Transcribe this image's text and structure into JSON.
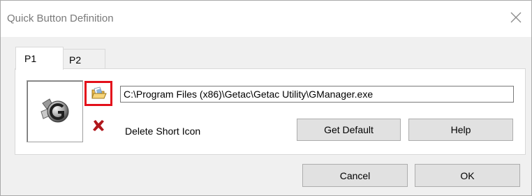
{
  "window": {
    "title": "Quick Button Definition"
  },
  "tabs": [
    {
      "label": "P1",
      "selected": true
    },
    {
      "label": "P2",
      "selected": false
    }
  ],
  "icon_preview": {
    "icon": "getac-gear-icon"
  },
  "browse": {
    "icon": "folder-open-icon"
  },
  "path_field": {
    "value": "C:\\Program Files (x86)\\Getac\\Getac Utility\\GManager.exe"
  },
  "delete": {
    "icon": "red-x-icon",
    "label": "Delete Short Icon"
  },
  "buttons": {
    "get_default": "Get Default",
    "help": "Help",
    "cancel": "Cancel",
    "ok": "OK"
  },
  "colors": {
    "highlight": "#e3101b",
    "delete_x": "#b0161b"
  }
}
